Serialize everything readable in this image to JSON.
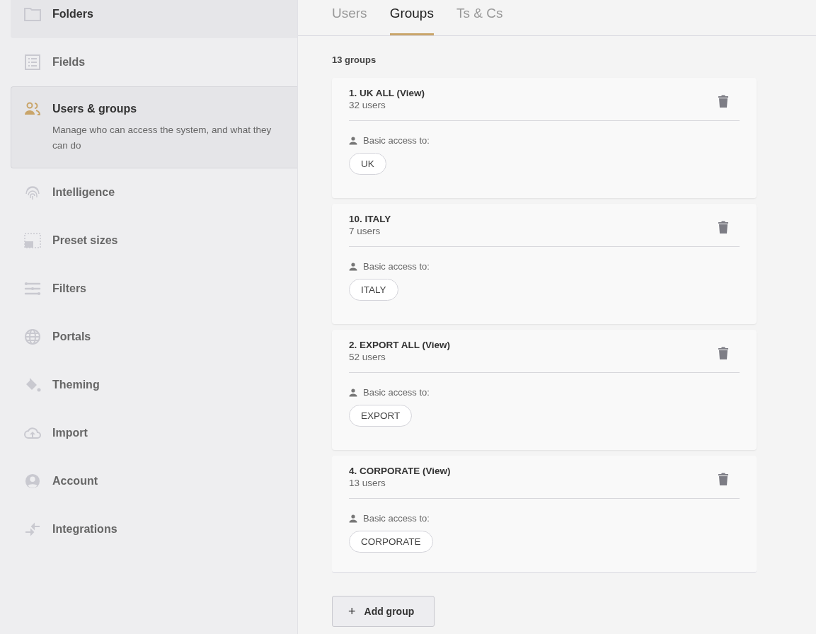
{
  "sidebar": {
    "items": [
      {
        "kind": "folder",
        "label": "Folders",
        "selected": false,
        "hovered": true
      },
      {
        "kind": "list",
        "label": "Fields",
        "selected": false,
        "hovered": false
      },
      {
        "kind": "users",
        "label": "Users & groups",
        "description": "Manage who can access the system, and what they can do",
        "selected": true,
        "hovered": false
      },
      {
        "kind": "fingerprint",
        "label": "Intelligence",
        "selected": false,
        "hovered": false
      },
      {
        "kind": "image",
        "label": "Preset sizes",
        "selected": false,
        "hovered": false
      },
      {
        "kind": "sliders",
        "label": "Filters",
        "selected": false,
        "hovered": false
      },
      {
        "kind": "globe",
        "label": "Portals",
        "selected": false,
        "hovered": false
      },
      {
        "kind": "bucket",
        "label": "Theming",
        "selected": false,
        "hovered": false
      },
      {
        "kind": "cloud",
        "label": "Import",
        "selected": false,
        "hovered": false
      },
      {
        "kind": "account",
        "label": "Account",
        "selected": false,
        "hovered": false
      },
      {
        "kind": "arrows",
        "label": "Integrations",
        "selected": false,
        "hovered": false
      }
    ]
  },
  "tabs": [
    {
      "label": "Users",
      "selected": false
    },
    {
      "label": "Groups",
      "selected": true
    },
    {
      "label": "Ts & Cs",
      "selected": false
    }
  ],
  "group_count": "13 groups",
  "groups": [
    {
      "name": "1. UK ALL (View)",
      "users": "32 users",
      "access_label": "Basic access to:",
      "tags": [
        "UK"
      ]
    },
    {
      "name": "10. ITALY",
      "users": "7 users",
      "access_label": "Basic access to:",
      "tags": [
        "ITALY"
      ]
    },
    {
      "name": "2. EXPORT ALL (View)",
      "users": "52 users",
      "access_label": "Basic access to:",
      "tags": [
        "EXPORT"
      ]
    },
    {
      "name": "4. CORPORATE (View)",
      "users": "13 users",
      "access_label": "Basic access to:",
      "tags": [
        "CORPORATE"
      ]
    }
  ],
  "add_button": {
    "icon": "+",
    "label": "Add group"
  }
}
